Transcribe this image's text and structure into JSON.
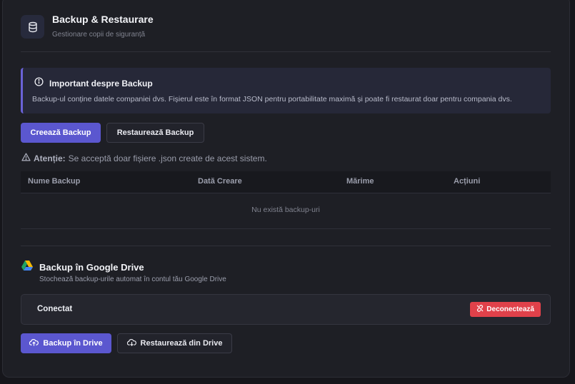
{
  "header": {
    "title": "Backup & Restaurare",
    "subtitle": "Gestionare copii de siguranță",
    "icon": "database-icon"
  },
  "info": {
    "title": "Important despre Backup",
    "text": "Backup-ul conține datele companiei dvs. Fișierul este în format JSON pentru portabilitate maximă și poate fi restaurat doar pentru compania dvs.",
    "accent": "#6a62d8"
  },
  "actions": {
    "create_backup": "Creează Backup",
    "restore_backup": "Restaurează Backup"
  },
  "warning": {
    "label": "Atenție:",
    "text": "Se acceptă doar fișiere .json create de acest sistem."
  },
  "table": {
    "columns": [
      "Nume Backup",
      "Dată Creare",
      "Mărime",
      "Acțiuni"
    ],
    "empty_text": "Nu există backup-uri"
  },
  "google_drive": {
    "title": "Backup în Google Drive",
    "subtitle": "Stochează backup-urile automat în contul tău Google Drive",
    "status": "Conectat",
    "disconnect_label": "Deconectează",
    "backup_label": "Backup în Drive",
    "restore_label": "Restaurează din Drive"
  },
  "colors": {
    "primary": "#5b57cf",
    "danger": "#e0414a",
    "background": "#1e1f25"
  }
}
